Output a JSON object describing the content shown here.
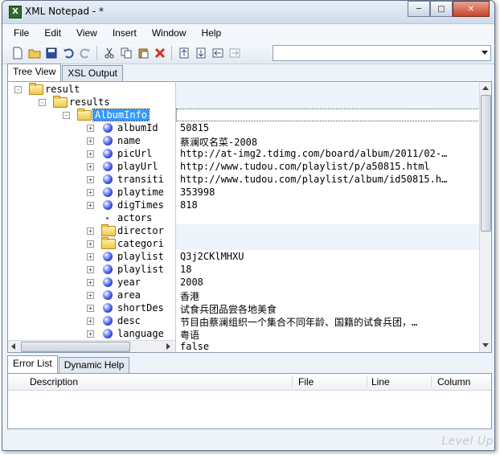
{
  "window": {
    "title": "XML Notepad - *"
  },
  "caption_buttons": {
    "minimize": "─",
    "maximize": "□",
    "close": "✕"
  },
  "menu": [
    "File",
    "Edit",
    "View",
    "Insert",
    "Window",
    "Help"
  ],
  "toolbar_icons": [
    "new-file-icon",
    "open-folder-icon",
    "save-icon",
    "undo-icon",
    "redo-icon",
    "cut-icon",
    "copy-icon",
    "paste-icon",
    "delete-icon",
    "nudge-up-icon",
    "nudge-down-icon",
    "nudge-left-icon",
    "nudge-right-icon"
  ],
  "top_tabs": [
    "Tree View",
    "XSL Output"
  ],
  "tree": [
    {
      "label": "result",
      "type": "folder",
      "expand": "-",
      "indent": 0
    },
    {
      "label": "results",
      "type": "folder",
      "expand": "-",
      "indent": 1
    },
    {
      "label": "AlbumInfo",
      "type": "folder",
      "expand": "-",
      "indent": 2,
      "selected": true
    },
    {
      "label": "albumId",
      "type": "ball",
      "expand": "+",
      "indent": 3
    },
    {
      "label": "name",
      "type": "ball",
      "expand": "+",
      "indent": 3
    },
    {
      "label": "picUrl",
      "type": "ball",
      "expand": "+",
      "indent": 3
    },
    {
      "label": "playUrl",
      "type": "ball",
      "expand": "+",
      "indent": 3
    },
    {
      "label": "transiti",
      "type": "ball",
      "expand": "+",
      "indent": 3
    },
    {
      "label": "playtime",
      "type": "ball",
      "expand": "+",
      "indent": 3
    },
    {
      "label": "digTimes",
      "type": "ball",
      "expand": "+",
      "indent": 3
    },
    {
      "label": "actors",
      "type": "dot",
      "expand": "",
      "indent": 3
    },
    {
      "label": "director",
      "type": "folder",
      "expand": "+",
      "indent": 3
    },
    {
      "label": "categori",
      "type": "folder",
      "expand": "+",
      "indent": 3
    },
    {
      "label": "playlist",
      "type": "ball",
      "expand": "+",
      "indent": 3
    },
    {
      "label": "playlist",
      "type": "ball",
      "expand": "+",
      "indent": 3
    },
    {
      "label": "year",
      "type": "ball",
      "expand": "+",
      "indent": 3
    },
    {
      "label": "area",
      "type": "ball",
      "expand": "+",
      "indent": 3
    },
    {
      "label": "shortDes",
      "type": "ball",
      "expand": "+",
      "indent": 3
    },
    {
      "label": "desc",
      "type": "ball",
      "expand": "+",
      "indent": 3
    },
    {
      "label": "language",
      "type": "ball",
      "expand": "+",
      "indent": 3
    }
  ],
  "values": [
    {
      "text": "",
      "shaded": true
    },
    {
      "text": "",
      "shaded": true
    },
    {
      "text": "",
      "shaded": false
    },
    {
      "text": "50815",
      "shaded": false
    },
    {
      "text": "蔡澜叹名菜-2008",
      "shaded": false
    },
    {
      "text": "http://at-img2.tdimg.com/board/album/2011/02-…",
      "shaded": false
    },
    {
      "text": "http://www.tudou.com/playlist/p/a50815.html",
      "shaded": false
    },
    {
      "text": "http://www.tudou.com/playlist/album/id50815.h…",
      "shaded": false
    },
    {
      "text": "353998",
      "shaded": false
    },
    {
      "text": "818",
      "shaded": false
    },
    {
      "text": "",
      "shaded": false
    },
    {
      "text": "",
      "shaded": true
    },
    {
      "text": "",
      "shaded": true
    },
    {
      "text": "Q3j2CKlMHXU",
      "shaded": false
    },
    {
      "text": "18",
      "shaded": false
    },
    {
      "text": "2008",
      "shaded": false
    },
    {
      "text": "香港",
      "shaded": false
    },
    {
      "text": "试食兵团品尝各地美食",
      "shaded": false
    },
    {
      "text": "节目由蔡澜组织一个集合不同年龄、国籍的试食兵团，…",
      "shaded": false
    },
    {
      "text": "粤语",
      "shaded": false
    },
    {
      "text": "false",
      "shaded": false
    }
  ],
  "bottom_tabs": [
    "Error List",
    "Dynamic Help"
  ],
  "error_list": {
    "columns": [
      "Description",
      "File",
      "Line",
      "Column"
    ]
  },
  "watermark": "Level Up"
}
